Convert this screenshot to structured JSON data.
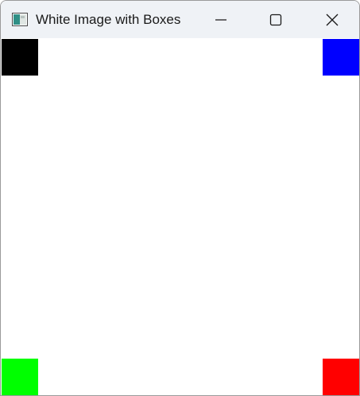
{
  "window": {
    "title": "White Image with Boxes",
    "app_icon": "image-app-icon",
    "controls": {
      "minimize_icon": "minimize-icon",
      "maximize_icon": "maximize-icon",
      "close_icon": "close-icon"
    }
  },
  "boxes": {
    "top_left": {
      "color": "#000000"
    },
    "top_right": {
      "color": "#0000ff"
    },
    "bottom_left": {
      "color": "#00ff00"
    },
    "bottom_right": {
      "color": "#ff0000"
    }
  }
}
